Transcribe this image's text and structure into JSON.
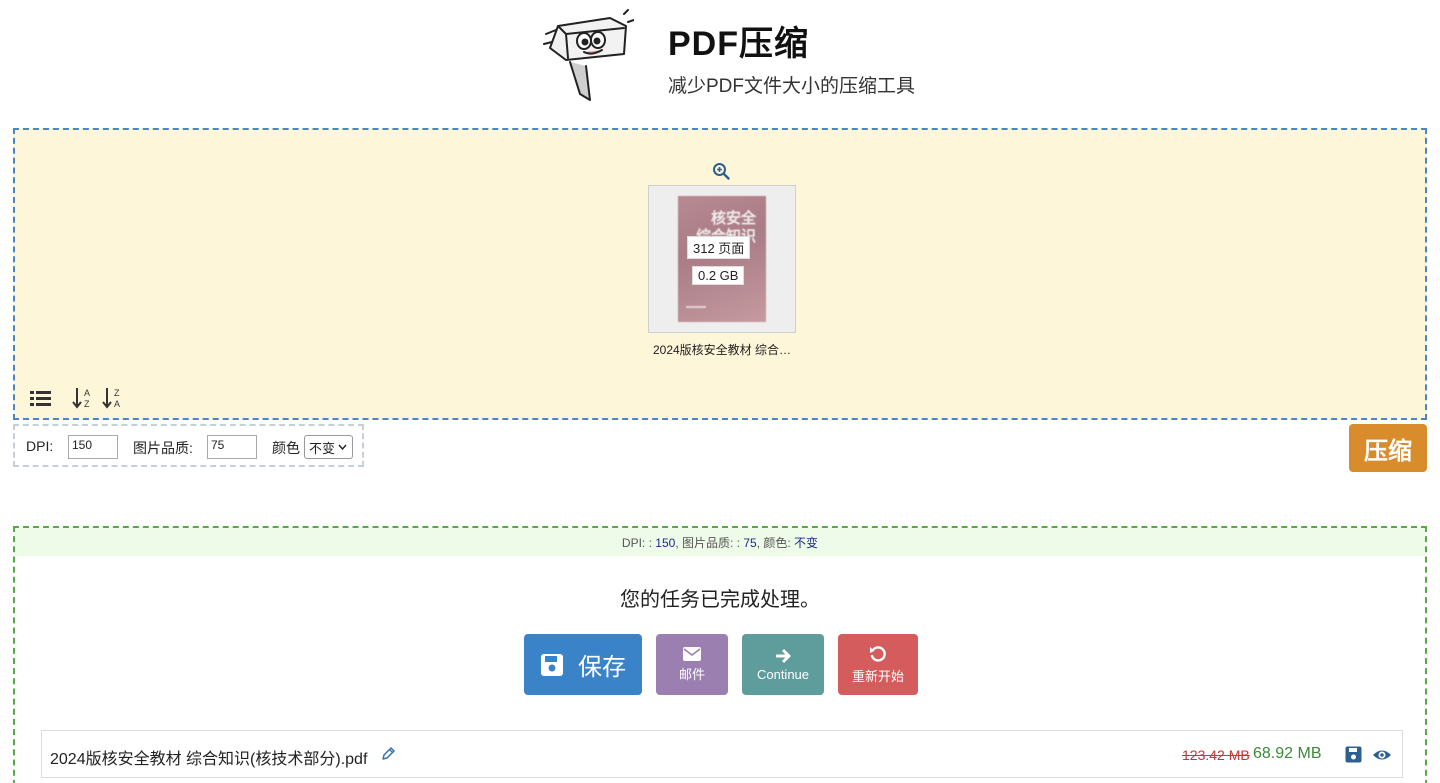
{
  "header": {
    "title": "PDF压缩",
    "subtitle": "减少PDF文件大小的压缩工具"
  },
  "preview": {
    "zoom_icon": "zoom-in-icon",
    "thumbnail": {
      "cover_title_line1": "核安全",
      "cover_title_line2": "综合知识",
      "pages": "312 页面",
      "size": "0.2 GB",
      "file_name": "2024版核安全教材 综合…"
    },
    "tools": [
      "list-view-icon",
      "sort-az-icon",
      "sort-za-icon"
    ]
  },
  "options": {
    "dpi_label": "DPI:",
    "dpi_value": "150",
    "quality_label": "图片品质:",
    "quality_value": "75",
    "color_label": "颜色",
    "color_value": "不变"
  },
  "compress_button": "压缩",
  "result": {
    "summary": {
      "dpi_label": "DPI: :",
      "dpi_value": "150",
      "quality_label": ", 图片品质: :",
      "quality_value": "75",
      "color_label": ", 颜色:",
      "color_value": "不变"
    },
    "message": "您的任务已完成处理。",
    "buttons": {
      "save": "保存",
      "mail": "邮件",
      "continue": "Continue",
      "restart": "重新开始"
    },
    "file": {
      "name": "2024版核安全教材 综合知识(核技术部分).pdf",
      "old_size": "123.42 MB",
      "new_size": "68.92 MB"
    }
  },
  "colors": {
    "dropzone_bg": "#fef6d9",
    "dropzone_border": "#4a86c5",
    "compress": "#d98c2c",
    "save": "#3a83c9",
    "mail": "#9b7fb0",
    "continue": "#5f9c9c",
    "restart": "#d55c5c",
    "result_border": "#55aa44"
  }
}
